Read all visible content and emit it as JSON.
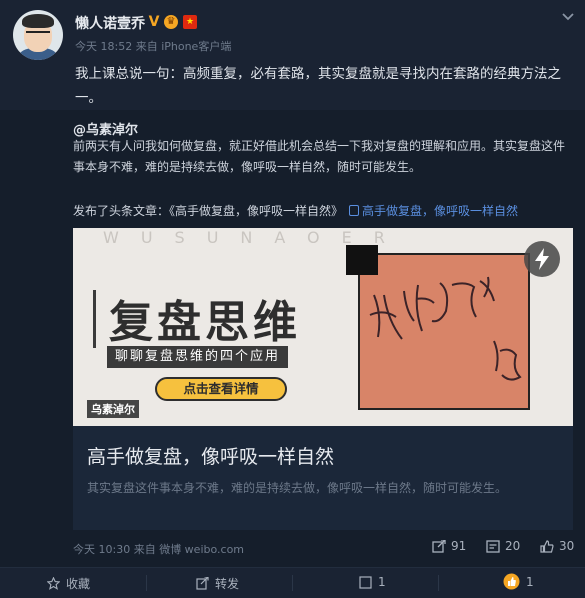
{
  "post": {
    "username": "懒人诺壹乔",
    "verified_badge": "V",
    "meta": "今天 18:52 来自 iPhone客户端",
    "text": "我上课总说一句：高频重复，必有套路，其实复盘就是寻找内在套路的经典方法之一。"
  },
  "quoted": {
    "mention": "@乌素淖尔",
    "text": "前两天有人问我如何做复盘，就正好借此机会总结一下我对复盘的理解和应用。其实复盘这件事本身不难，难的是持续去做，像呼吸一样自然，随时可能发生。",
    "article_prefix": "发布了头条文章：《高手做复盘，像呼吸一样自然》",
    "article_link": "高手做复盘，像呼吸一样自然",
    "article": {
      "cover_watermark": "WUSUNAOER",
      "cover_title": "复盘思维",
      "cover_subtitle": "聊聊复盘思维的四个应用",
      "cover_button": "点击查看详情",
      "cover_logo": "乌素淖尔",
      "title": "高手做复盘，像呼吸一样自然",
      "description": "其实复盘这件事本身不难，难的是持续去做，像呼吸一样自然，随时可能发生。"
    },
    "meta": "今天 10:30 来自 微博 weibo.com",
    "stats": {
      "reposts": "91",
      "comments": "20",
      "likes": "30"
    }
  },
  "actions": {
    "favorite": "收藏",
    "repost": "转发",
    "comment": "1",
    "like": "1"
  },
  "colors": {
    "accent": "#5a8fe0",
    "badge": "#f5a623",
    "background": "#151e2b"
  }
}
